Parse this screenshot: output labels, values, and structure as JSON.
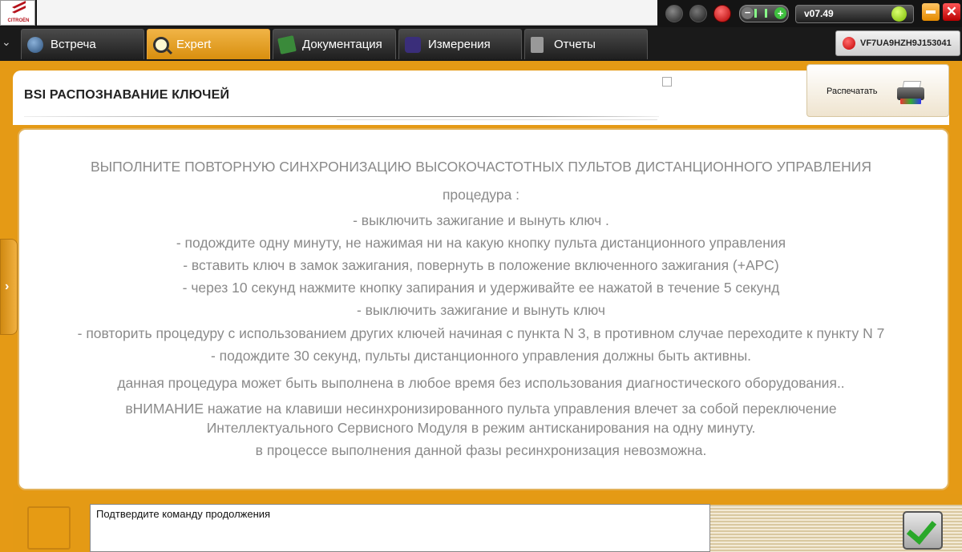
{
  "titlebar": {
    "logo_text": "CITROËN",
    "version": "v07.49",
    "minimize_icon": "minimize-icon",
    "close_icon": "close-icon",
    "close_glyph": "✕"
  },
  "tabs": [
    {
      "label": "Встреча",
      "icon": "meeting-icon"
    },
    {
      "label": "Expert",
      "icon": "magnifier-icon",
      "active": true
    },
    {
      "label": "Документация",
      "icon": "book-icon"
    },
    {
      "label": "Измерения",
      "icon": "waveform-icon"
    },
    {
      "label": "Отчеты",
      "icon": "report-icon"
    }
  ],
  "vin": "VF7UA9HZH9J153041",
  "page": {
    "title": "BSI  РАСПОЗНАВАНИЕ КЛЮЧЕЙ",
    "print_label": "Распечатать"
  },
  "instructions": {
    "heading": "ВЫПОЛНИТЕ ПОВТОРНУЮ СИНХРОНИЗАЦИЮ ВЫСОКОЧАСТОТНЫХ ПУЛЬТОВ ДИСТАНЦИОННОГО УПРАВЛЕНИЯ",
    "procedure_label": "процедура :",
    "steps": [
      "- выключить зажигание и вынуть ключ .",
      "- подождите одну минуту, не нажимая ни на какую кнопку пульта дистанционного управления",
      "- вставить ключ в замок зажигания, повернуть в положение включенного зажигания (+APC)",
      "- через 10 секунд нажмите кнопку запирания и удерживайте ее нажатой в течение 5 секунд",
      "- выключить зажигание и вынуть ключ",
      "- повторить процедуру с использованием других ключей начиная с пункта N 3, в противном случае переходите к пункту N 7",
      "- подождите 30 секунд, пульты дистанционного управления должны быть активны."
    ],
    "note1": "данная процедура может быть выполнена в любое время без использования диагностического оборудования..",
    "warning_line1": "вНИМАНИЕ нажатие на клавиши несинхронизированного пульта управления влечет за собой переключение",
    "warning_line2": "Интеллектуального Сервисного Модуля в режим антисканирования на одну минуту.",
    "note2": "в процессе выполнения данной фазы ресинхронизация невозможна."
  },
  "bottom": {
    "prompt": "Подтвердите команду продолжения"
  }
}
